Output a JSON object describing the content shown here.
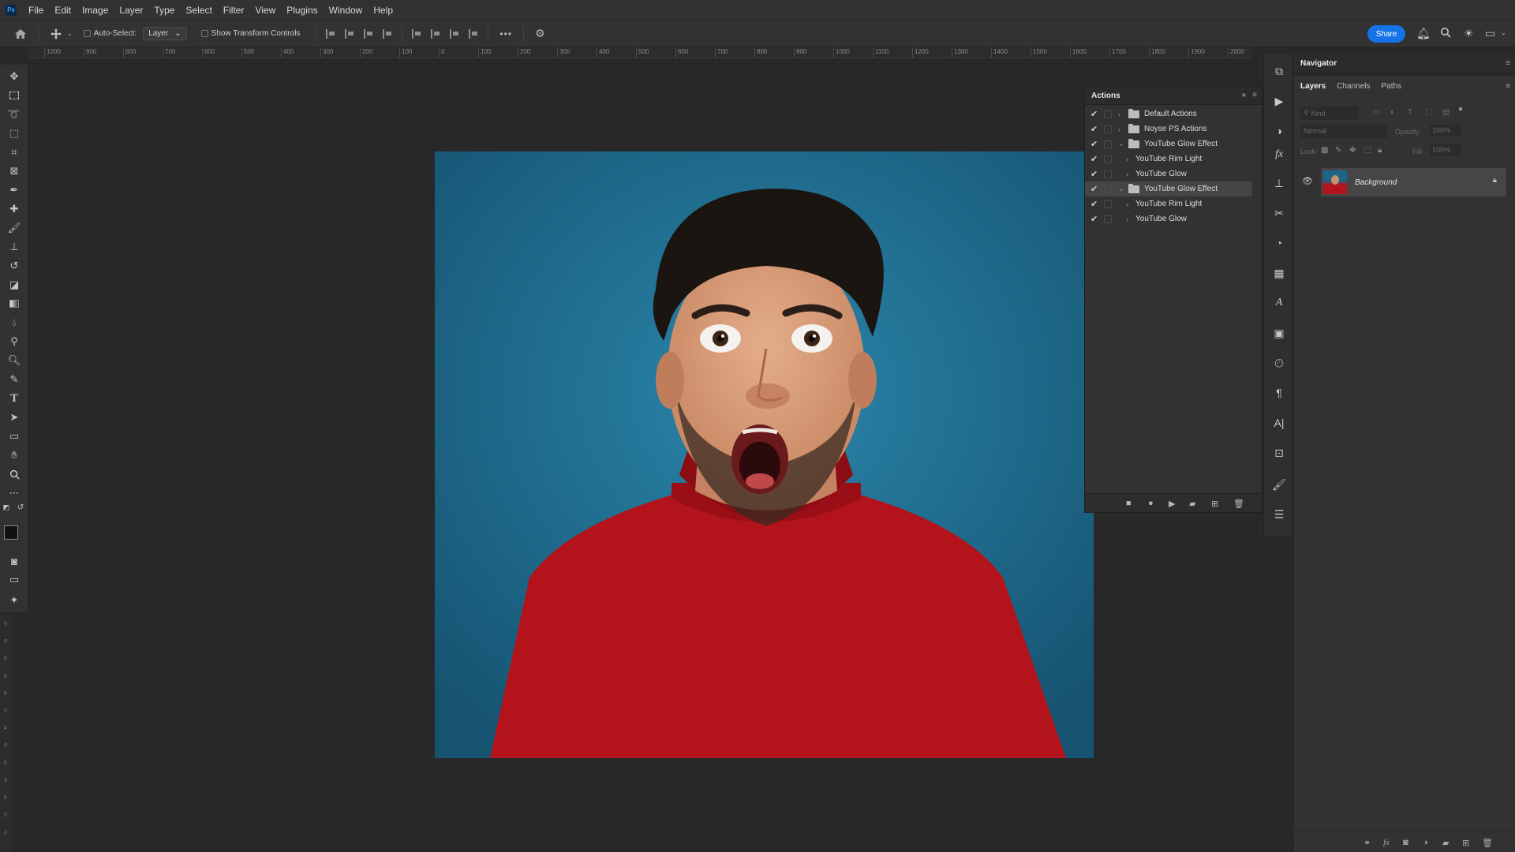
{
  "menu": {
    "items": [
      "File",
      "Edit",
      "Image",
      "Layer",
      "Type",
      "Select",
      "Filter",
      "View",
      "Plugins",
      "Window",
      "Help"
    ],
    "logo": "Ps"
  },
  "options": {
    "auto_select_label": "Auto-Select:",
    "auto_select_value": "Layer",
    "transform_label": "Show Transform Controls",
    "more": "•••",
    "share_label": "Share"
  },
  "ruler": {
    "h_labels": [
      "1000",
      "900",
      "800",
      "700",
      "600",
      "500",
      "400",
      "300",
      "200",
      "100",
      "0",
      "100",
      "200",
      "300",
      "400",
      "500",
      "600",
      "700",
      "800",
      "900",
      "1000",
      "1100",
      "1200",
      "1300",
      "1400",
      "1500",
      "1600",
      "1700",
      "1800",
      "1900",
      "2000"
    ],
    "v_labels": [
      "5",
      "0",
      "0",
      "5",
      "0",
      "0",
      "4",
      "0",
      "0",
      "3",
      "0",
      "0",
      "2"
    ]
  },
  "actions": {
    "title": "Actions",
    "rows": [
      {
        "label": "Default Actions",
        "type": "set",
        "expanded": false
      },
      {
        "label": "Noyse PS Actions",
        "type": "set",
        "expanded": false
      },
      {
        "label": "YouTube Glow Effect",
        "type": "set",
        "expanded": true
      },
      {
        "label": "YouTube Rim Light",
        "type": "action"
      },
      {
        "label": "YouTube Glow",
        "type": "action"
      },
      {
        "label": "YouTube Glow Effect",
        "type": "set",
        "expanded": true,
        "selected": true
      },
      {
        "label": "YouTube Rim Light",
        "type": "action"
      },
      {
        "label": "YouTube Glow",
        "type": "action"
      }
    ]
  },
  "panels": {
    "navigator_title": "Navigator",
    "tabs": [
      "Layers",
      "Channels",
      "Paths"
    ],
    "kind_placeholder": "Kind",
    "blend_mode": "Normal",
    "opacity_label": "Opacity:",
    "opacity_value": "100%",
    "lock_label": "Lock:",
    "fill_label": "Fill:",
    "fill_value": "100%",
    "layer_name": "Background"
  },
  "colors": {
    "accent": "#1473e6",
    "canvas_bg": "#1d6a8d",
    "shirt": "#b5141a"
  }
}
